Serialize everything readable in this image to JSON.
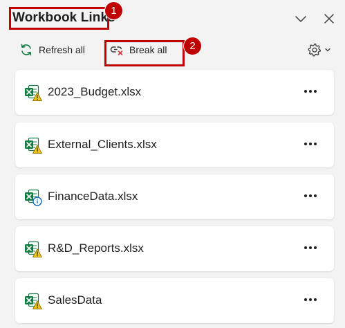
{
  "pane": {
    "title": "Workbook Links",
    "collapse_icon": "chevron-down-icon",
    "close_icon": "close-icon"
  },
  "toolbar": {
    "refresh_label": "Refresh all",
    "refresh_icon": "refresh-icon",
    "break_label": "Break all",
    "break_icon": "break-link-icon",
    "settings_icon": "gear-icon"
  },
  "callouts": [
    {
      "number": "1",
      "color": "#c00000"
    },
    {
      "number": "2",
      "color": "#c00000"
    }
  ],
  "links": [
    {
      "name": "2023_Budget.xlsx",
      "status": "warning",
      "icon": "excel-warning-icon"
    },
    {
      "name": "External_Clients.xlsx",
      "status": "warning",
      "icon": "excel-warning-icon"
    },
    {
      "name": "FinanceData.xlsx",
      "status": "info",
      "icon": "excel-info-icon"
    },
    {
      "name": "R&D_Reports.xlsx",
      "status": "warning",
      "icon": "excel-warning-icon"
    },
    {
      "name": "SalesData",
      "status": "warning",
      "icon": "excel-warning-icon"
    }
  ],
  "colors": {
    "background": "#f3f3f3",
    "card": "#ffffff",
    "excel_green": "#107c41",
    "warning_yellow": "#f2c811",
    "info_blue": "#0f6cbd",
    "callout_red": "#c00000",
    "refresh_green": "#107c41",
    "break_red": "#d13438"
  }
}
